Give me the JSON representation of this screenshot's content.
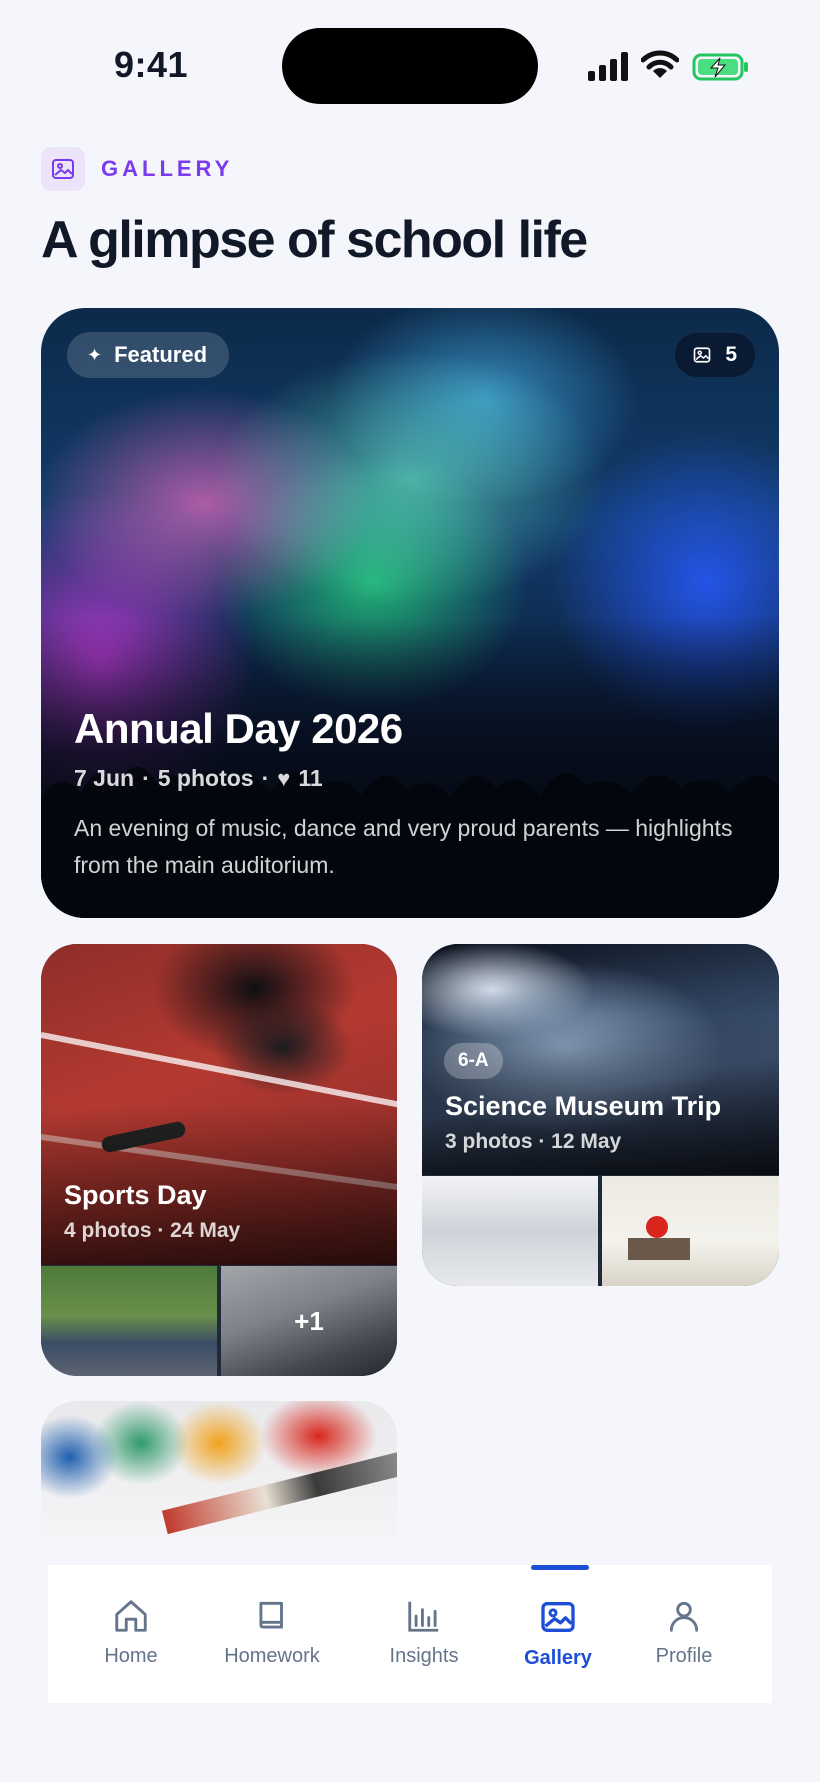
{
  "status_bar": {
    "time": "9:41"
  },
  "header": {
    "eyebrow": "GALLERY",
    "title": "A glimpse of school life"
  },
  "featured": {
    "badge": "Featured",
    "photo_count": "5",
    "title": "Annual Day 2026",
    "date": "7 Jun",
    "photos": "5 photos",
    "likes": "11",
    "description": "An evening of music, dance and very proud parents — highlights from the main auditorium."
  },
  "albums": [
    {
      "title": "Sports Day",
      "meta": "4 photos · 24 May",
      "more": "+1"
    },
    {
      "title": "Science Museum Trip",
      "meta": "3 photos · 12 May",
      "class_badge": "6-A"
    }
  ],
  "tabs": [
    {
      "label": "Home",
      "icon": "home-icon"
    },
    {
      "label": "Homework",
      "icon": "book-icon"
    },
    {
      "label": "Insights",
      "icon": "bar-chart-icon"
    },
    {
      "label": "Gallery",
      "icon": "image-icon",
      "active": true
    },
    {
      "label": "Profile",
      "icon": "user-icon"
    }
  ],
  "colors": {
    "accent": "#1d4ed8",
    "eyebrow": "#7c3aed",
    "background": "#f4f6fb"
  }
}
